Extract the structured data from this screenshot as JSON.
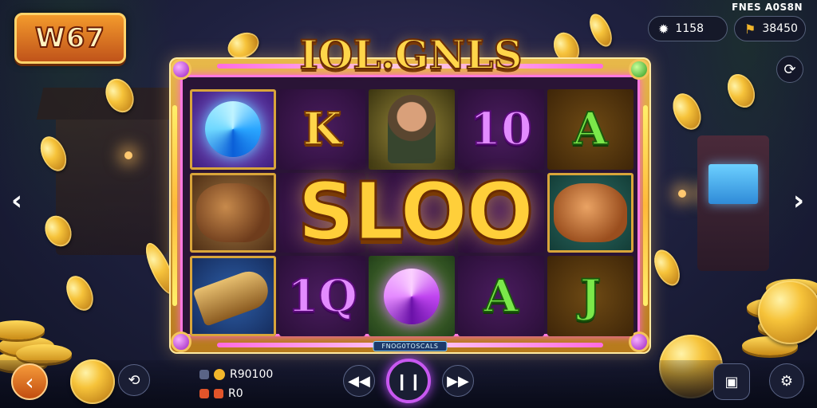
{
  "brand": {
    "logo_text": "W67"
  },
  "header": {
    "corner_label": "FNES A0S8N",
    "stat_a": {
      "icon": "gear-icon",
      "value": "1158"
    },
    "stat_b": {
      "icon": "trophy-icon",
      "value": "38450"
    },
    "refresh_icon": "refresh-icon"
  },
  "game": {
    "title": "IOL.GNLS",
    "center_text": "SLOO",
    "frame_caption": "FNOG0TOSCALS",
    "reels": [
      {
        "symbol": "blue-swirl"
      },
      {
        "symbol": "K"
      },
      {
        "symbol": "explorer"
      },
      {
        "symbol": "10"
      },
      {
        "symbol": "A"
      },
      {
        "symbol": "tiger"
      },
      {
        "symbol": "lynx"
      },
      {
        "symbol": "horn"
      },
      {
        "symbol": "1Q"
      },
      {
        "symbol": "violet-swirl"
      },
      {
        "symbol": "A"
      },
      {
        "symbol": "J"
      }
    ]
  },
  "nav": {
    "prev": "‹",
    "next": "›"
  },
  "footer": {
    "balance": "R90100",
    "bet": "R0",
    "icons": {
      "back": "back-arrow-icon",
      "sync": "sync-icon",
      "rewind": "rewind-icon",
      "pause": "pause-icon",
      "forward": "fast-forward-icon",
      "screen": "screen-icon",
      "settings": "settings-gear-icon"
    }
  },
  "colors": {
    "gold": "#ffd54a",
    "accent": "#c858f0",
    "frame": "#e8b94a"
  }
}
